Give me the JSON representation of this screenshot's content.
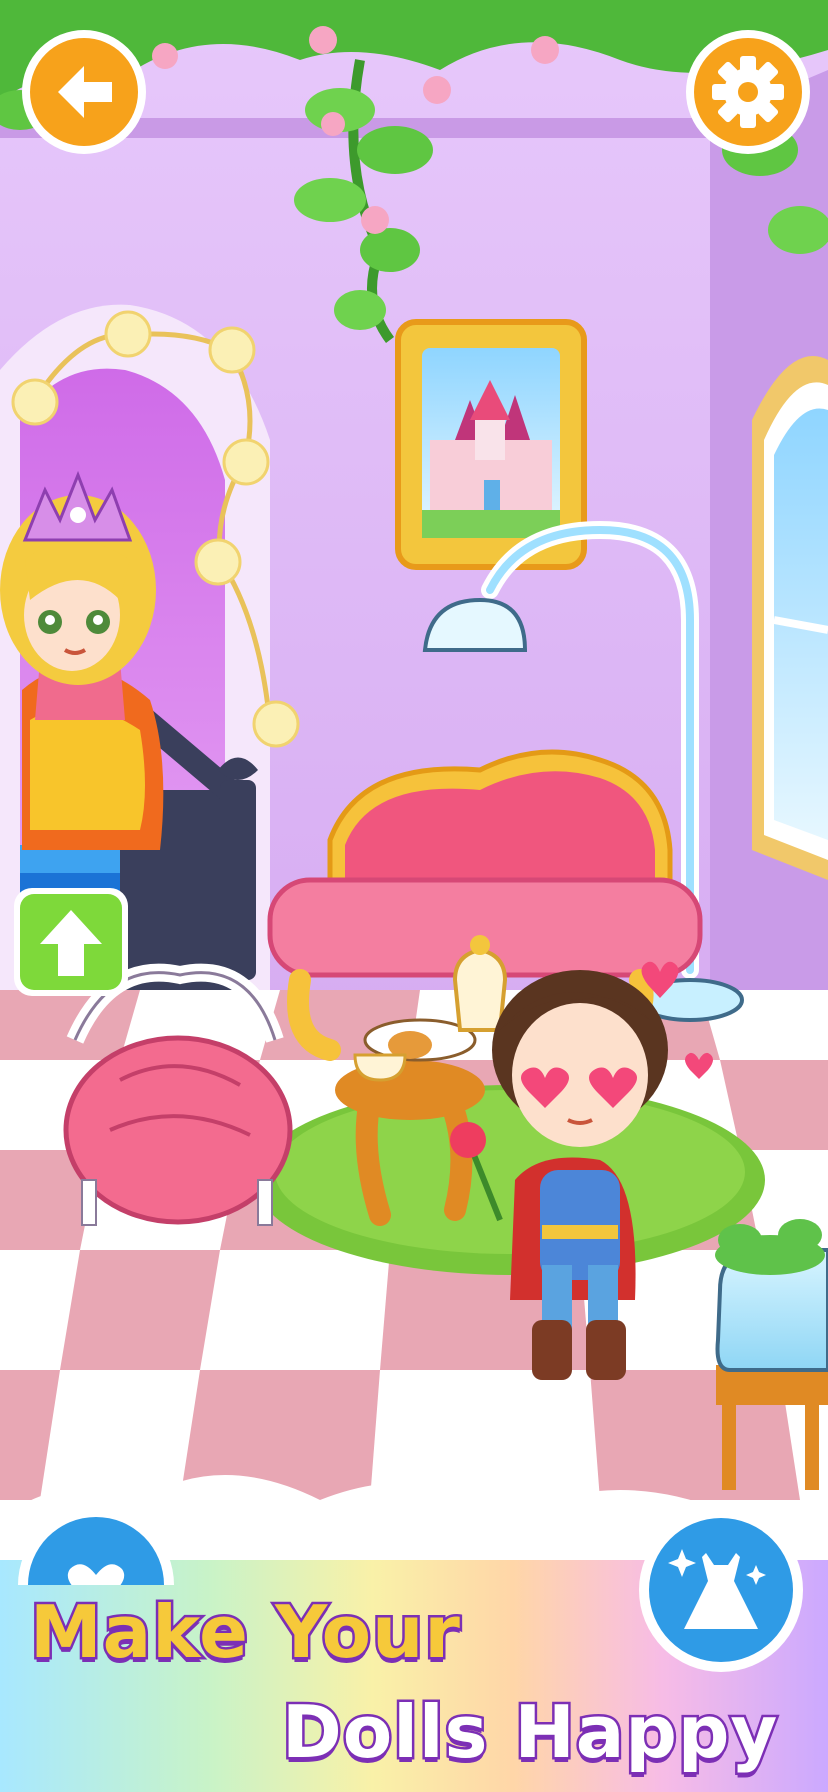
{
  "promo": {
    "headline_line1": "Make Your",
    "headline_line2": "Dolls Happy"
  },
  "icons": {
    "back": "back-arrow-icon",
    "settings": "gear-icon",
    "stairs_up": "up-arrow-icon",
    "favorites": "heart-icon",
    "wardrobe": "dress-icon"
  },
  "colors": {
    "wall": "#dcb6f3",
    "orange_button": "#f7a21b",
    "green_button": "#7ed93a",
    "blue_button": "#2f9be6",
    "floor_pink": "#e8a7b4",
    "floor_white": "#ffffff",
    "text_purple": "#7c2fb5",
    "text_yellow": "#f6c93a"
  }
}
